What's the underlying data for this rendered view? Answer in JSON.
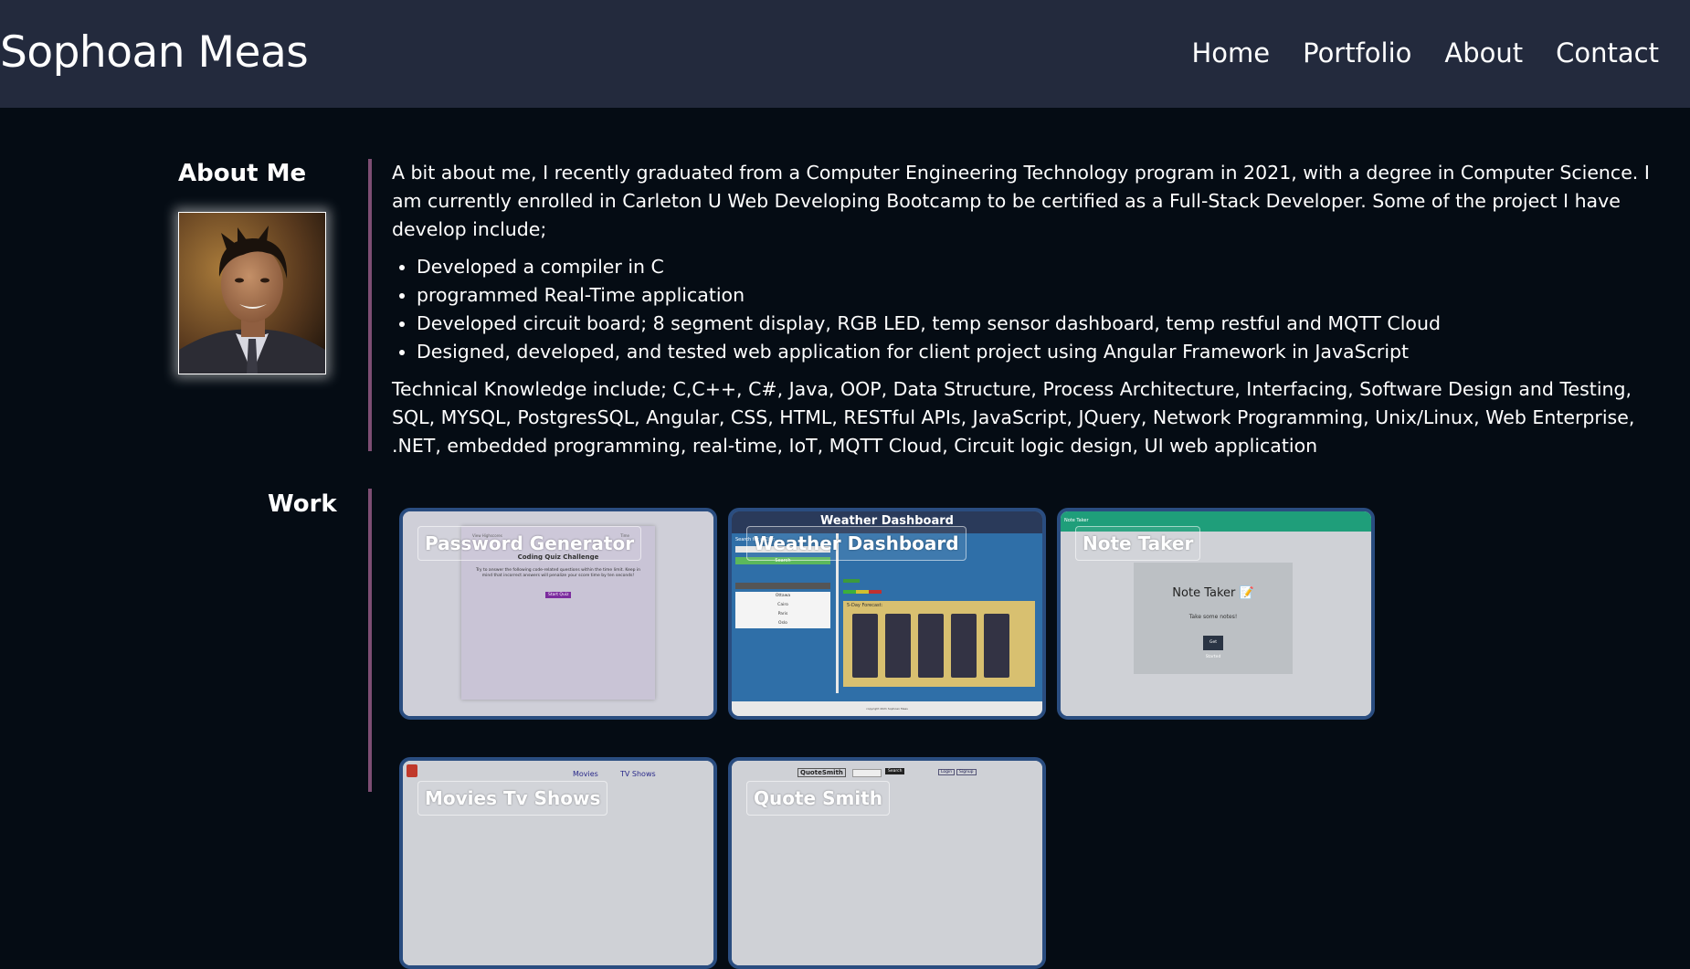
{
  "header": {
    "brand": "Sophoan Meas",
    "nav": [
      "Home",
      "Portfolio",
      "About",
      "Contact"
    ]
  },
  "about": {
    "title": "About Me",
    "intro": "A bit about me, I recently graduated from a Computer Engineering Technology program in 2021, with a degree in Computer Science. I am currently enrolled in Carleton U Web Developing Bootcamp to be certified as a Full-Stack Developer. Some of the project I have develop include;",
    "projects": [
      "Developed a compiler in C",
      "programmed Real-Time application",
      "Developed circuit board; 8 segment display, RGB LED, temp sensor dashboard, temp restful and MQTT Cloud",
      "Designed, developed, and tested web application for client project using Angular Framework in JavaScript"
    ],
    "technical": "Technical Knowledge include; C,C++, C#, Java, OOP, Data Structure, Process Architecture, Interfacing, Software Design and Testing, SQL, MYSQL, PostgresSQL, Angular, CSS, HTML, RESTful APIs, JavaScript, JQuery, Network Programming, Unix/Linux, Web Enterprise, .NET, embedded programming, real-time, IoT, MQTT Cloud, Circuit logic design, UI web application"
  },
  "work": {
    "title": "Work",
    "cards": [
      {
        "label": "Password Generator"
      },
      {
        "label": "Weather Dashboard"
      },
      {
        "label": "Note Taker"
      },
      {
        "label": "Movies Tv Shows"
      },
      {
        "label": "Quote Smith"
      }
    ],
    "thumbs": {
      "quiz": {
        "brand": "View Highscores",
        "timer": "Time",
        "heading": "Coding Quiz Challenge",
        "text": "Try to answer the following code-related questions within the time limit. Keep in mind that incorrect answers will penalize your score time by ten seconds!",
        "button": "Start Quiz"
      },
      "weather": {
        "heading": "Weather Dashboard",
        "search": "Search for a City:",
        "button": "Search",
        "forecast": "5-Day Forecast:",
        "cities": [
          "Ottawa",
          "Cairo",
          "Paris",
          "Oslo"
        ],
        "footer": "copyright 2021 Sophoan Meas"
      },
      "note": {
        "brand": "Note Taker",
        "title": "Note Taker 📝",
        "subtitle": "Take some notes!",
        "button": "Get Started"
      },
      "movies": {
        "nav_movies": "Movies",
        "nav_tv": "TV Shows"
      },
      "quote": {
        "logo": "QuoteSmith",
        "nav_one": "Login",
        "nav_two": "Signup",
        "search": "Search"
      }
    }
  }
}
